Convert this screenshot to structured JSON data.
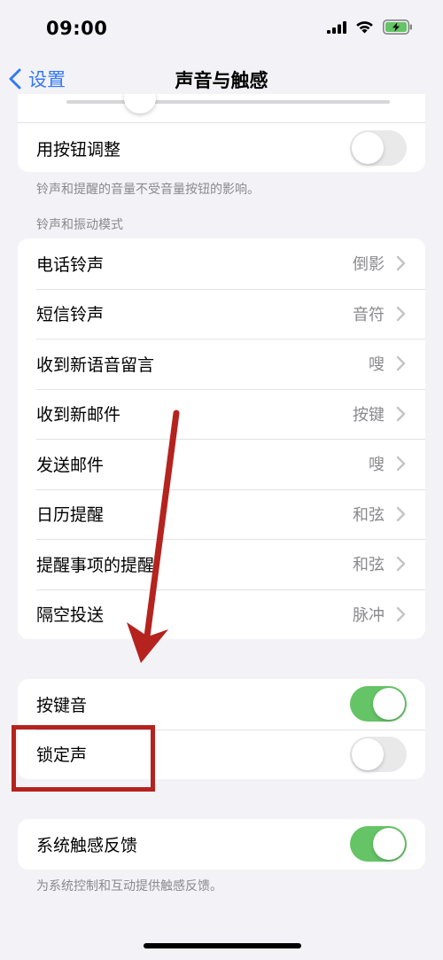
{
  "status_bar": {
    "time": "09:00"
  },
  "nav": {
    "back_label": "设置",
    "title": "声音与触感"
  },
  "volume_group": {
    "toggle_label": "用按钮调整",
    "toggle_on": false,
    "footnote": "铃声和提醒的音量不受音量按钮的影响。"
  },
  "sounds_section": {
    "header": "铃声和振动模式",
    "items": [
      {
        "label": "电话铃声",
        "value": "倒影"
      },
      {
        "label": "短信铃声",
        "value": "音符"
      },
      {
        "label": "收到新语音留言",
        "value": "嗖"
      },
      {
        "label": "收到新邮件",
        "value": "按键"
      },
      {
        "label": "发送邮件",
        "value": "嗖"
      },
      {
        "label": "日历提醒",
        "value": "和弦"
      },
      {
        "label": "提醒事项的提醒",
        "value": "和弦"
      },
      {
        "label": "隔空投送",
        "value": "脉冲"
      }
    ]
  },
  "clicks_group": {
    "items": [
      {
        "label": "按键音",
        "on": true
      },
      {
        "label": "锁定声",
        "on": false
      }
    ]
  },
  "haptics_group": {
    "label": "系统触感反馈",
    "on": true,
    "footnote": "为系统控制和互动提供触感反馈。"
  },
  "colors": {
    "accent": "#3478f6",
    "toggle_on": "#65c466",
    "toggle_off": "#e9e9ea",
    "annotation": "#b5231f"
  }
}
